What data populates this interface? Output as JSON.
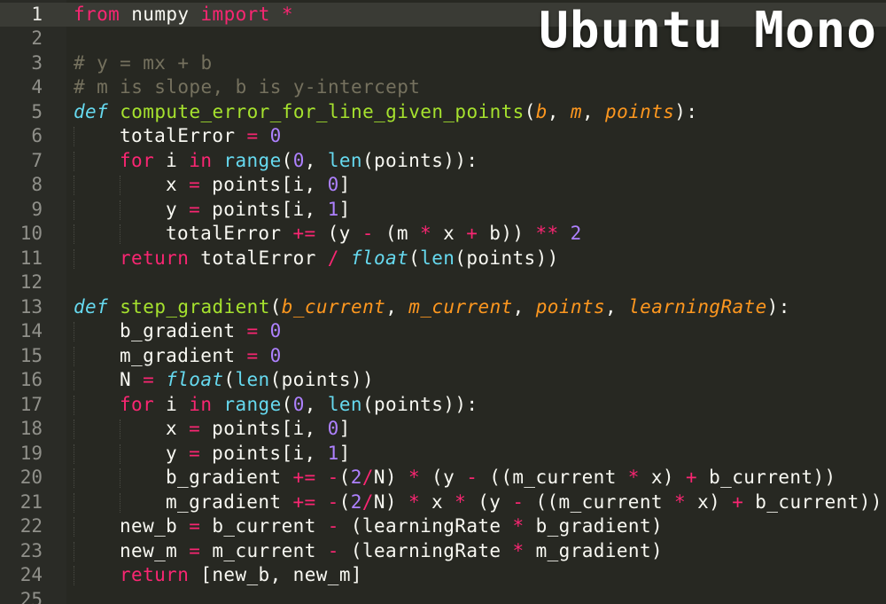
{
  "editor": {
    "overlay_title": "Ubuntu Mono",
    "active_line": 1,
    "colors": {
      "background": "#272822",
      "keyword": "#f92672",
      "function": "#a6e22e",
      "number": "#ae81ff",
      "builtin": "#66d9ef",
      "parameter": "#fd971f",
      "comment": "#75715e",
      "text": "#f8f8f2"
    },
    "lines": [
      {
        "n": "1",
        "indent": 0,
        "tokens": [
          [
            "kw",
            "from"
          ],
          [
            "id",
            " numpy "
          ],
          [
            "kw",
            "import"
          ],
          [
            "id",
            " "
          ],
          [
            "op",
            "*"
          ]
        ]
      },
      {
        "n": "2",
        "indent": 0,
        "tokens": []
      },
      {
        "n": "3",
        "indent": 0,
        "tokens": [
          [
            "cm",
            "# y = mx + b"
          ]
        ]
      },
      {
        "n": "4",
        "indent": 0,
        "tokens": [
          [
            "cm",
            "# m is slope, b is y-intercept"
          ]
        ]
      },
      {
        "n": "5",
        "indent": 0,
        "tokens": [
          [
            "def",
            "def"
          ],
          [
            "id",
            " "
          ],
          [
            "fn",
            "compute_error_for_line_given_points"
          ],
          [
            "id",
            "("
          ],
          [
            "param",
            "b"
          ],
          [
            "id",
            ", "
          ],
          [
            "param",
            "m"
          ],
          [
            "id",
            ", "
          ],
          [
            "param",
            "points"
          ],
          [
            "id",
            "):"
          ]
        ]
      },
      {
        "n": "6",
        "indent": 1,
        "tokens": [
          [
            "id",
            "totalError "
          ],
          [
            "op",
            "="
          ],
          [
            "id",
            " "
          ],
          [
            "num",
            "0"
          ]
        ]
      },
      {
        "n": "7",
        "indent": 1,
        "tokens": [
          [
            "kw",
            "for"
          ],
          [
            "id",
            " i "
          ],
          [
            "kw",
            "in"
          ],
          [
            "id",
            " "
          ],
          [
            "builtin",
            "range"
          ],
          [
            "id",
            "("
          ],
          [
            "num",
            "0"
          ],
          [
            "id",
            ", "
          ],
          [
            "builtin",
            "len"
          ],
          [
            "id",
            "(points)):"
          ]
        ]
      },
      {
        "n": "8",
        "indent": 2,
        "tokens": [
          [
            "id",
            "x "
          ],
          [
            "op",
            "="
          ],
          [
            "id",
            " points[i, "
          ],
          [
            "num",
            "0"
          ],
          [
            "id",
            "]"
          ]
        ]
      },
      {
        "n": "9",
        "indent": 2,
        "tokens": [
          [
            "id",
            "y "
          ],
          [
            "op",
            "="
          ],
          [
            "id",
            " points[i, "
          ],
          [
            "num",
            "1"
          ],
          [
            "id",
            "]"
          ]
        ]
      },
      {
        "n": "10",
        "indent": 2,
        "tokens": [
          [
            "id",
            "totalError "
          ],
          [
            "op",
            "+="
          ],
          [
            "id",
            " (y "
          ],
          [
            "op",
            "-"
          ],
          [
            "id",
            " (m "
          ],
          [
            "op",
            "*"
          ],
          [
            "id",
            " x "
          ],
          [
            "op",
            "+"
          ],
          [
            "id",
            " b)) "
          ],
          [
            "op",
            "**"
          ],
          [
            "id",
            " "
          ],
          [
            "num",
            "2"
          ]
        ]
      },
      {
        "n": "11",
        "indent": 1,
        "tokens": [
          [
            "kw",
            "return"
          ],
          [
            "id",
            " totalError "
          ],
          [
            "op",
            "/"
          ],
          [
            "id",
            " "
          ],
          [
            "builtinit",
            "float"
          ],
          [
            "id",
            "("
          ],
          [
            "builtin",
            "len"
          ],
          [
            "id",
            "(points))"
          ]
        ]
      },
      {
        "n": "12",
        "indent": 0,
        "tokens": []
      },
      {
        "n": "13",
        "indent": 0,
        "tokens": [
          [
            "def",
            "def"
          ],
          [
            "id",
            " "
          ],
          [
            "fn",
            "step_gradient"
          ],
          [
            "id",
            "("
          ],
          [
            "param",
            "b_current"
          ],
          [
            "id",
            ", "
          ],
          [
            "param",
            "m_current"
          ],
          [
            "id",
            ", "
          ],
          [
            "param",
            "points"
          ],
          [
            "id",
            ", "
          ],
          [
            "param",
            "learningRate"
          ],
          [
            "id",
            "):"
          ]
        ]
      },
      {
        "n": "14",
        "indent": 1,
        "tokens": [
          [
            "id",
            "b_gradient "
          ],
          [
            "op",
            "="
          ],
          [
            "id",
            " "
          ],
          [
            "num",
            "0"
          ]
        ]
      },
      {
        "n": "15",
        "indent": 1,
        "tokens": [
          [
            "id",
            "m_gradient "
          ],
          [
            "op",
            "="
          ],
          [
            "id",
            " "
          ],
          [
            "num",
            "0"
          ]
        ]
      },
      {
        "n": "16",
        "indent": 1,
        "tokens": [
          [
            "id",
            "N "
          ],
          [
            "op",
            "="
          ],
          [
            "id",
            " "
          ],
          [
            "builtinit",
            "float"
          ],
          [
            "id",
            "("
          ],
          [
            "builtin",
            "len"
          ],
          [
            "id",
            "(points))"
          ]
        ]
      },
      {
        "n": "17",
        "indent": 1,
        "tokens": [
          [
            "kw",
            "for"
          ],
          [
            "id",
            " i "
          ],
          [
            "kw",
            "in"
          ],
          [
            "id",
            " "
          ],
          [
            "builtin",
            "range"
          ],
          [
            "id",
            "("
          ],
          [
            "num",
            "0"
          ],
          [
            "id",
            ", "
          ],
          [
            "builtin",
            "len"
          ],
          [
            "id",
            "(points)):"
          ]
        ]
      },
      {
        "n": "18",
        "indent": 2,
        "tokens": [
          [
            "id",
            "x "
          ],
          [
            "op",
            "="
          ],
          [
            "id",
            " points[i, "
          ],
          [
            "num",
            "0"
          ],
          [
            "id",
            "]"
          ]
        ]
      },
      {
        "n": "19",
        "indent": 2,
        "tokens": [
          [
            "id",
            "y "
          ],
          [
            "op",
            "="
          ],
          [
            "id",
            " points[i, "
          ],
          [
            "num",
            "1"
          ],
          [
            "id",
            "]"
          ]
        ]
      },
      {
        "n": "20",
        "indent": 2,
        "tokens": [
          [
            "id",
            "b_gradient "
          ],
          [
            "op",
            "+="
          ],
          [
            "id",
            " "
          ],
          [
            "op",
            "-"
          ],
          [
            "id",
            "("
          ],
          [
            "num",
            "2"
          ],
          [
            "op",
            "/"
          ],
          [
            "id",
            "N) "
          ],
          [
            "op",
            "*"
          ],
          [
            "id",
            " (y "
          ],
          [
            "op",
            "-"
          ],
          [
            "id",
            " ((m_current "
          ],
          [
            "op",
            "*"
          ],
          [
            "id",
            " x) "
          ],
          [
            "op",
            "+"
          ],
          [
            "id",
            " b_current))"
          ]
        ]
      },
      {
        "n": "21",
        "indent": 2,
        "tokens": [
          [
            "id",
            "m_gradient "
          ],
          [
            "op",
            "+="
          ],
          [
            "id",
            " "
          ],
          [
            "op",
            "-"
          ],
          [
            "id",
            "("
          ],
          [
            "num",
            "2"
          ],
          [
            "op",
            "/"
          ],
          [
            "id",
            "N) "
          ],
          [
            "op",
            "*"
          ],
          [
            "id",
            " x "
          ],
          [
            "op",
            "*"
          ],
          [
            "id",
            " (y "
          ],
          [
            "op",
            "-"
          ],
          [
            "id",
            " ((m_current "
          ],
          [
            "op",
            "*"
          ],
          [
            "id",
            " x) "
          ],
          [
            "op",
            "+"
          ],
          [
            "id",
            " b_current))"
          ]
        ]
      },
      {
        "n": "22",
        "indent": 1,
        "tokens": [
          [
            "id",
            "new_b "
          ],
          [
            "op",
            "="
          ],
          [
            "id",
            " b_current "
          ],
          [
            "op",
            "-"
          ],
          [
            "id",
            " (learningRate "
          ],
          [
            "op",
            "*"
          ],
          [
            "id",
            " b_gradient)"
          ]
        ]
      },
      {
        "n": "23",
        "indent": 1,
        "tokens": [
          [
            "id",
            "new_m "
          ],
          [
            "op",
            "="
          ],
          [
            "id",
            " m_current "
          ],
          [
            "op",
            "-"
          ],
          [
            "id",
            " (learningRate "
          ],
          [
            "op",
            "*"
          ],
          [
            "id",
            " m_gradient)"
          ]
        ]
      },
      {
        "n": "24",
        "indent": 1,
        "tokens": [
          [
            "kw",
            "return"
          ],
          [
            "id",
            " [new_b, new_m]"
          ]
        ]
      },
      {
        "n": "25",
        "indent": 0,
        "tokens": []
      }
    ]
  }
}
